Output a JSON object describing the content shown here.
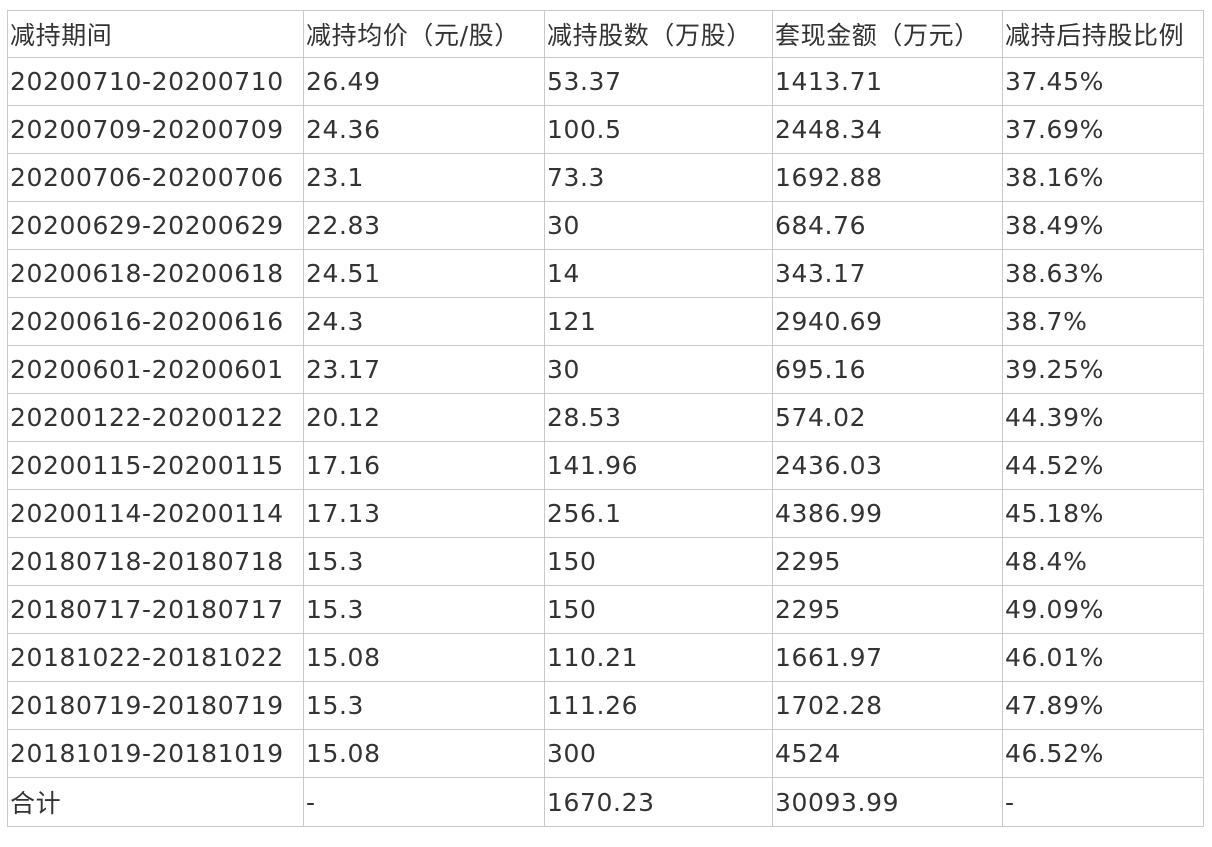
{
  "table": {
    "headers": [
      "减持期间",
      "减持均价（元/股）",
      "减持股数（万股）",
      "套现金额（万元）",
      "减持后持股比例"
    ],
    "rows": [
      [
        "20200710-20200710",
        "26.49",
        "53.37",
        "1413.71",
        "37.45%"
      ],
      [
        "20200709-20200709",
        "24.36",
        "100.5",
        "2448.34",
        "37.69%"
      ],
      [
        "20200706-20200706",
        "23.1",
        "73.3",
        "1692.88",
        "38.16%"
      ],
      [
        "20200629-20200629",
        "22.83",
        "30",
        "684.76",
        "38.49%"
      ],
      [
        "20200618-20200618",
        "24.51",
        "14",
        "343.17",
        "38.63%"
      ],
      [
        "20200616-20200616",
        "24.3",
        "121",
        "2940.69",
        "38.7%"
      ],
      [
        "20200601-20200601",
        "23.17",
        "30",
        "695.16",
        "39.25%"
      ],
      [
        "20200122-20200122",
        "20.12",
        "28.53",
        "574.02",
        "44.39%"
      ],
      [
        "20200115-20200115",
        "17.16",
        "141.96",
        "2436.03",
        "44.52%"
      ],
      [
        "20200114-20200114",
        "17.13",
        "256.1",
        "4386.99",
        "45.18%"
      ],
      [
        "20180718-20180718",
        "15.3",
        "150",
        "2295",
        "48.4%"
      ],
      [
        "20180717-20180717",
        "15.3",
        "150",
        "2295",
        "49.09%"
      ],
      [
        "20181022-20181022",
        "15.08",
        "110.21",
        "1661.97",
        "46.01%"
      ],
      [
        "20180719-20180719",
        "15.3",
        "111.26",
        "1702.28",
        "47.89%"
      ],
      [
        "20181019-20181019",
        "15.08",
        "300",
        "4524",
        "46.52%"
      ]
    ],
    "total": [
      "合计",
      "-",
      "1670.23",
      "30093.99",
      "-"
    ]
  }
}
